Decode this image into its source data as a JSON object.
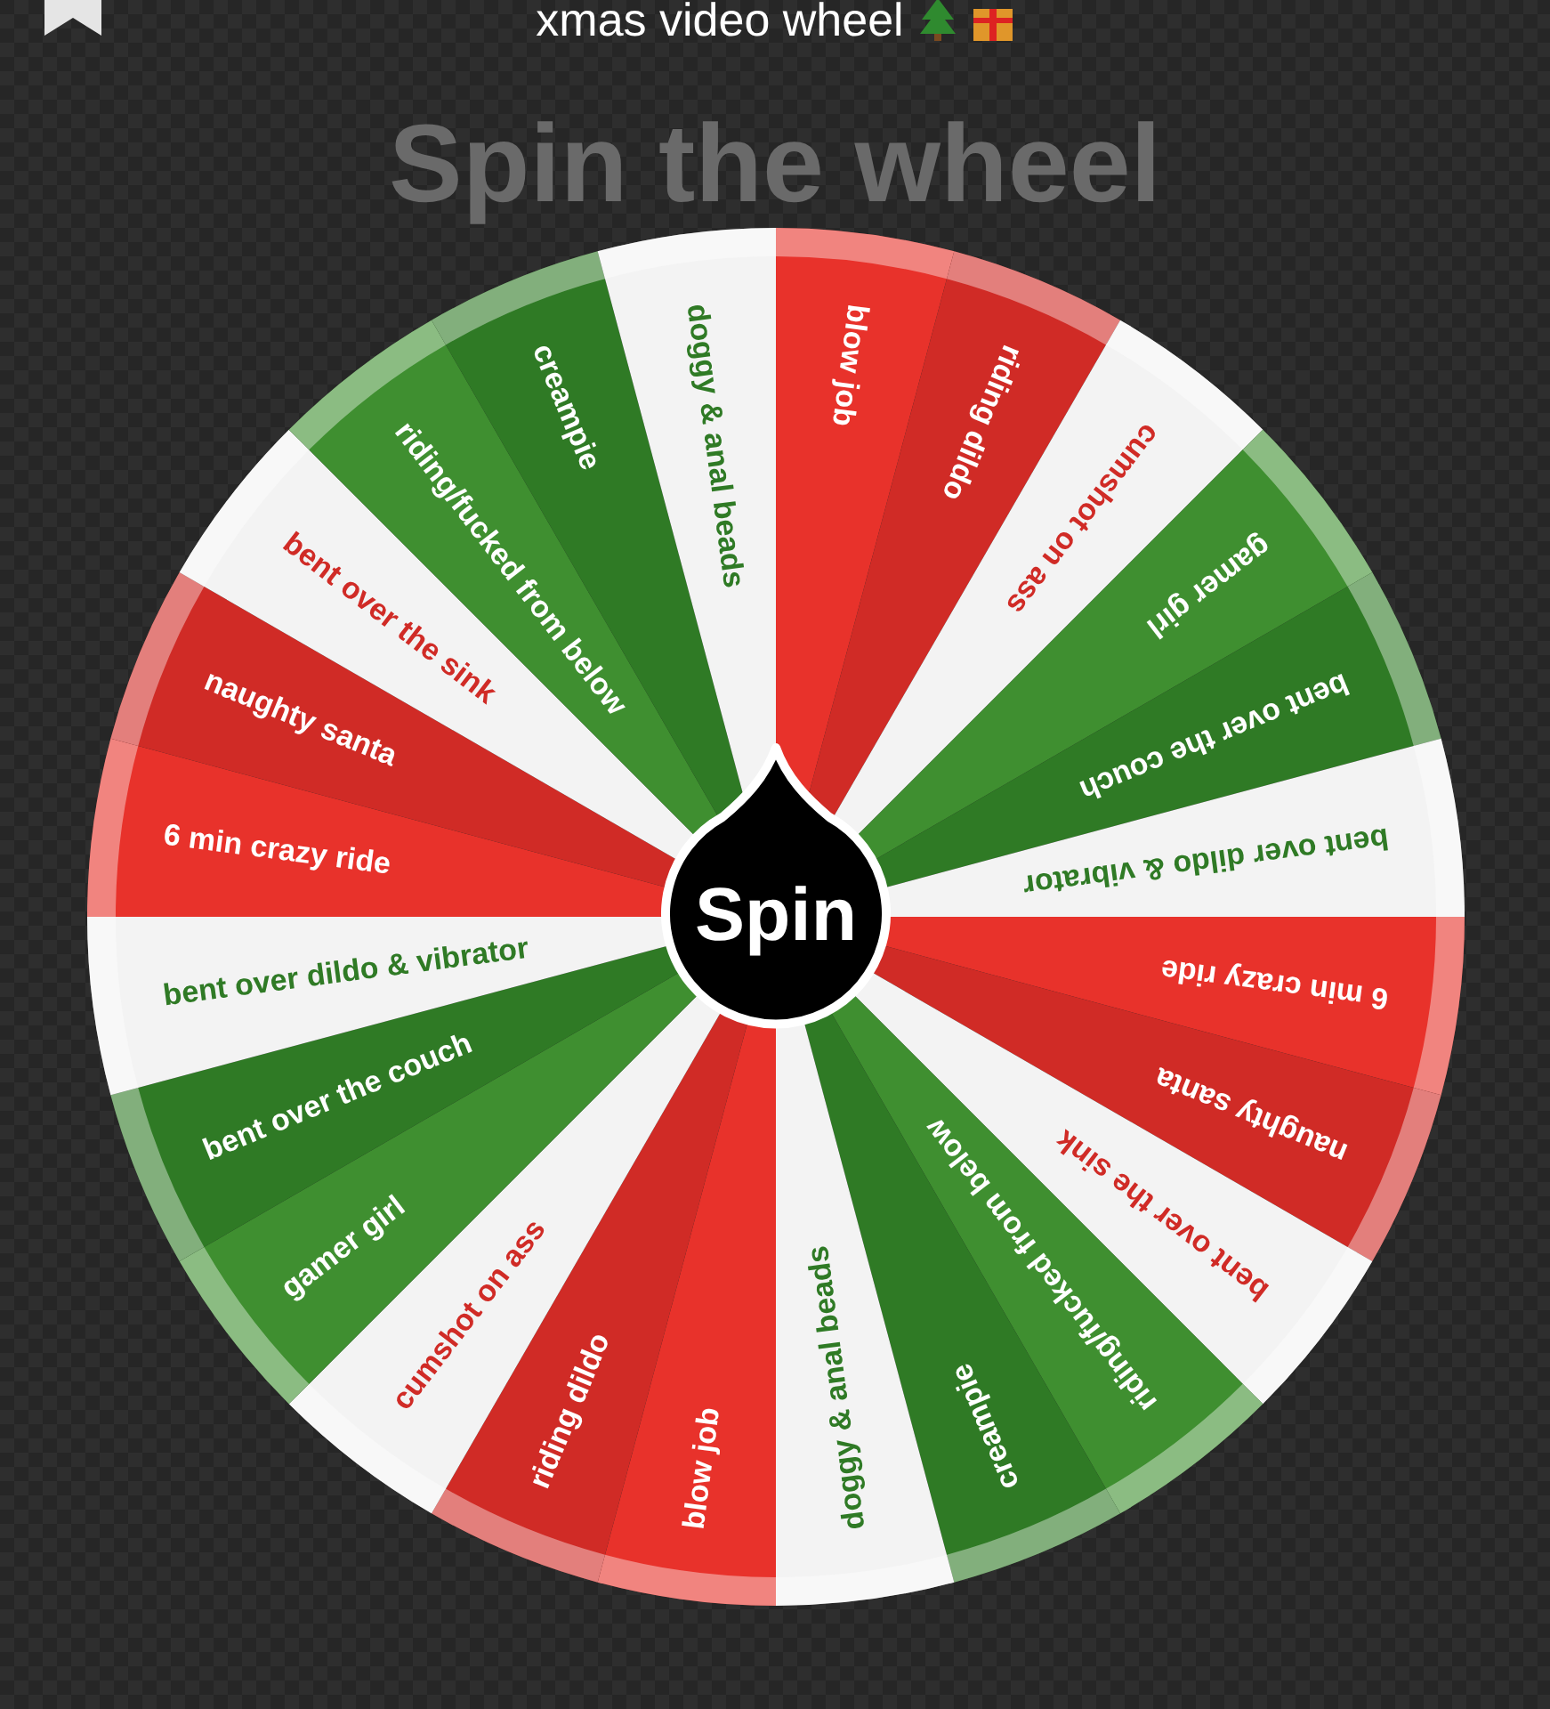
{
  "header": {
    "title": "xmas video wheel"
  },
  "heading": "Spin the wheel",
  "wheel": {
    "button": "Spin",
    "segments": [
      {
        "label": "blow job",
        "color": "#e8322b",
        "kind": "solid"
      },
      {
        "label": "riding dildo",
        "color": "#d02b26",
        "kind": "solid"
      },
      {
        "label": "cumshot on ass",
        "color": "#f3f3f3",
        "kind": "light"
      },
      {
        "label": "gamer girl",
        "color": "#3f8f30",
        "kind": "solid"
      },
      {
        "label": "bent over the couch",
        "color": "#2f7a25",
        "kind": "solid"
      },
      {
        "label": "bent over dildo & vibrator",
        "color": "#f3f3f3",
        "kind": "light"
      },
      {
        "label": "6 min crazy ride",
        "color": "#e8322b",
        "kind": "solid"
      },
      {
        "label": "naughty santa",
        "color": "#d02b26",
        "kind": "solid"
      },
      {
        "label": "bent over the sink",
        "color": "#f3f3f3",
        "kind": "light"
      },
      {
        "label": "riding/fucked from below",
        "color": "#3f8f30",
        "kind": "solid"
      },
      {
        "label": "creampie",
        "color": "#2f7a25",
        "kind": "solid"
      },
      {
        "label": "doggy & anal beads",
        "color": "#f3f3f3",
        "kind": "light"
      },
      {
        "label": "blow job",
        "color": "#e8322b",
        "kind": "solid"
      },
      {
        "label": "riding dildo",
        "color": "#d02b26",
        "kind": "solid"
      },
      {
        "label": "cumshot on ass",
        "color": "#f3f3f3",
        "kind": "light"
      },
      {
        "label": "gamer girl",
        "color": "#3f8f30",
        "kind": "solid"
      },
      {
        "label": "bent over the couch",
        "color": "#2f7a25",
        "kind": "solid"
      },
      {
        "label": "bent over dildo & vibrator",
        "color": "#f3f3f3",
        "kind": "light"
      },
      {
        "label": "6 min crazy ride",
        "color": "#e8322b",
        "kind": "solid"
      },
      {
        "label": "naughty santa",
        "color": "#d02b26",
        "kind": "solid"
      },
      {
        "label": "bent over the sink",
        "color": "#f3f3f3",
        "kind": "light"
      },
      {
        "label": "riding/fucked from below",
        "color": "#3f8f30",
        "kind": "solid"
      },
      {
        "label": "creampie",
        "color": "#2f7a25",
        "kind": "solid"
      },
      {
        "label": "doggy & anal beads",
        "color": "#f3f3f3",
        "kind": "light"
      }
    ]
  }
}
